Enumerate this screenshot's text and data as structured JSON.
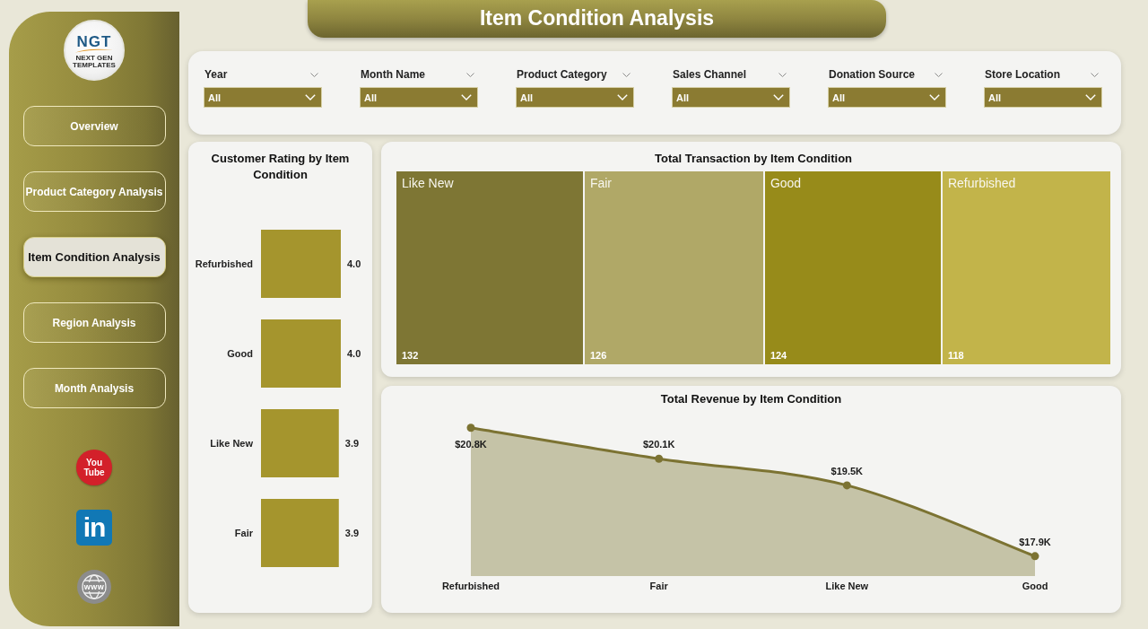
{
  "title": "Item Condition Analysis",
  "logo": {
    "mark": "NGT",
    "tagline": "NEXT GEN TEMPLATES"
  },
  "nav": [
    {
      "label": "Overview",
      "selected": false
    },
    {
      "label": "Product Category Analysis",
      "selected": false
    },
    {
      "label": "Item Condition Analysis",
      "selected": true
    },
    {
      "label": "Region Analysis",
      "selected": false
    },
    {
      "label": "Month Analysis",
      "selected": false
    }
  ],
  "social_links": [
    {
      "kind": "video",
      "label": "You Tube"
    },
    {
      "kind": "profile",
      "label": "in"
    },
    {
      "kind": "website",
      "label": "www"
    }
  ],
  "filters": [
    {
      "label": "Year",
      "value": "All"
    },
    {
      "label": "Month Name",
      "value": "All"
    },
    {
      "label": "Product Category",
      "value": "All"
    },
    {
      "label": "Sales Channel",
      "value": "All"
    },
    {
      "label": "Donation Source",
      "value": "All"
    },
    {
      "label": "Store Location",
      "value": "All"
    }
  ],
  "rating_chart": {
    "chart_data": {
      "type": "bar",
      "orientation": "horizontal",
      "title": "Customer Rating by Item Condition",
      "categories": [
        "Refurbished",
        "Good",
        "Like New",
        "Fair"
      ],
      "values": [
        4.0,
        4.0,
        3.9,
        3.9
      ],
      "value_labels": [
        "4.0",
        "4.0",
        "3.9",
        "3.9"
      ]
    }
  },
  "transaction_treemap": {
    "title": "Total Transaction by Item Condition",
    "cells": [
      {
        "label": "Like New",
        "value": "132",
        "color": "#7e7634"
      },
      {
        "label": "Fair",
        "value": "126",
        "color": "#b0a867"
      },
      {
        "label": "Good",
        "value": "124",
        "color": "#978b1a"
      },
      {
        "label": "Refurbished",
        "value": "118",
        "color": "#c2b44a"
      }
    ]
  },
  "revenue_chart": {
    "chart_data": {
      "type": "area",
      "title": "Total Revenue by Item Condition",
      "categories": [
        "Refurbished",
        "Fair",
        "Like New",
        "Good"
      ],
      "values": [
        20800,
        20100,
        19500,
        17900
      ],
      "value_labels": [
        "$20.8K",
        "$20.1K",
        "$19.5K",
        "$17.9K"
      ]
    }
  }
}
